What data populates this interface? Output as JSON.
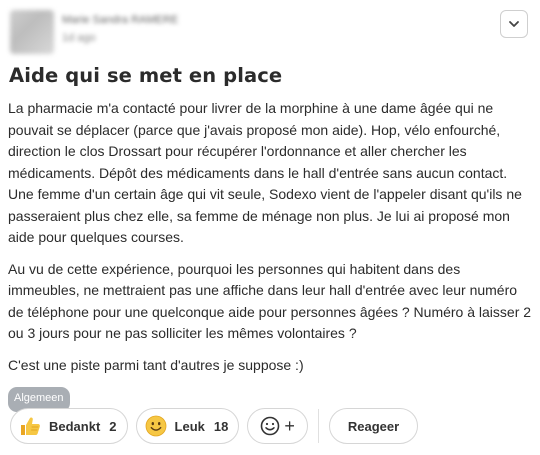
{
  "author": {
    "name": "Marie Sandra RAMERE",
    "time": "1d ago"
  },
  "post": {
    "title": "Aide qui se met en place",
    "paragraphs": [
      "La pharmacie m'a contacté pour livrer de la morphine à une dame âgée qui ne pouvait se déplacer (parce que j'avais proposé mon aide). Hop, vélo enfourché, direction le clos Drossart pour récupérer l'ordonnance et aller chercher les médicaments. Dépôt des médicaments dans le hall d'entrée sans aucun contact. Une femme d'un certain âge qui vit seule, Sodexo vient de l'appeler disant qu'ils ne passeraient plus chez elle, sa femme de ménage non plus. Je lui ai proposé mon aide pour quelques courses.",
      "Au vu de cette expérience, pourquoi les personnes qui habitent dans des immeubles, ne mettraient pas une affiche dans leur hall d'entrée avec leur numéro de téléphone pour une quelconque aide pour personnes âgées ? Numéro à laisser 2 ou 3 jours pour ne pas solliciter les mêmes volontaires ?",
      "C'est une piste parmi tant d'autres je suppose :)"
    ],
    "tag": "Algemeen"
  },
  "reactions": [
    {
      "label": "Bedankt",
      "count": "2",
      "icon": "thumbs-up-icon"
    },
    {
      "label": "Leuk",
      "count": "18",
      "icon": "smile-icon"
    }
  ],
  "actions": {
    "add_reaction_symbol": "+",
    "reply_label": "Reageer"
  },
  "colors": {
    "tag_bg": "#a9aeb4",
    "emoji_yellow": "#f6c744"
  }
}
